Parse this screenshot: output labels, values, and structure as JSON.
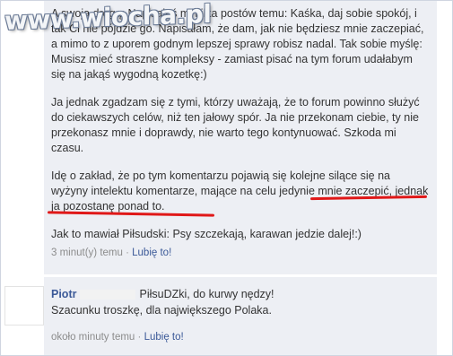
{
  "watermark": "www.wiocha.pl",
  "post": {
    "paragraphs": [
      "A swoją drogą: Napisałaś mi kilka postów temu: Kaśka, daj sobie spokój, i tak Ci nie pójdzie go. Napisałam, że dam, jak nie będziesz mnie zaczepiać, a mimo to z uporem godnym lepszej sprawy robisz nadal. Tak sobie myślę: Musisz mieć straszne kompleksy - zamiast pisać na tym forum udałabym się na jakąś wygodną kozetkę:)",
      "Ja jednak zgadzam się z tymi, którzy uważają, że to forum powinno służyć do ciekawszych celów, niż ten jałowy spór. Ja nie przekonam ciebie, ty nie przekonasz mnie i doprawdy, nie warto tego kontynuować. Szkoda mi czasu.",
      "Idę o zakład, że po tym komentarzu pojawią się kolejne silące się na wyżyny intelektu komentarze, mające na celu jedynie mnie zaczepić, jednak ja pozostanę ponad to.",
      "Jak to mawiał Piłsudski: Psy szczekają, karawan jedzie dalej!:)"
    ],
    "meta_time": "3 minut(y) temu",
    "meta_sep": "·",
    "meta_like": "Lubię to!"
  },
  "reply": {
    "author": "Piotr",
    "line1": "PiłsuDZki, do kurwy nędzy!",
    "line2": "Szacunku troszkę, dla największego Polaka.",
    "meta_time": "około minuty temu",
    "meta_sep": "·",
    "meta_like": "Lubię to!"
  },
  "colors": {
    "block_bg": "#edeff4",
    "link": "#3b5998",
    "underline": "#e01818"
  }
}
